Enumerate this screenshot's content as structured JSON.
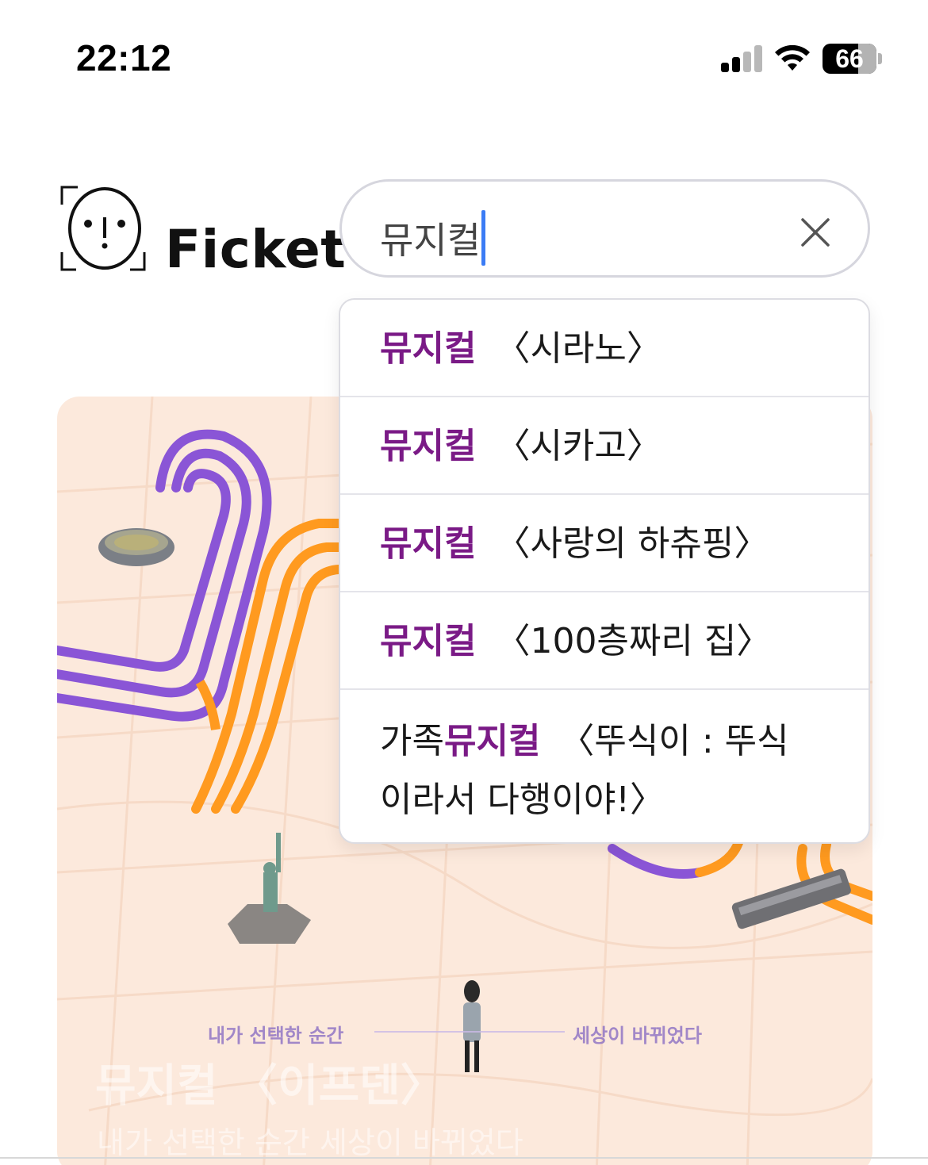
{
  "status_bar": {
    "time": "22:12",
    "battery": "66",
    "icons": [
      "signal-icon",
      "wifi-icon",
      "battery-icon"
    ]
  },
  "logo": {
    "text": "Ficket",
    "icon": "face-logo-icon"
  },
  "search": {
    "value": "뮤지컬",
    "clear_icon": "close-icon"
  },
  "suggestions": [
    {
      "prefix": "",
      "match": "뮤지컬",
      "rest": "〈시라노〉"
    },
    {
      "prefix": "",
      "match": "뮤지컬",
      "rest": "〈시카고〉"
    },
    {
      "prefix": "",
      "match": "뮤지컬",
      "rest": "〈사랑의 하츄핑〉"
    },
    {
      "prefix": "",
      "match": "뮤지컬",
      "rest": "〈100층짜리 집〉"
    },
    {
      "prefix": "가족",
      "match": "뮤지컬",
      "rest": "〈뚜식이 : 뚜식이라서 다행이야!〉"
    }
  ],
  "banner": {
    "title": "뮤지컬 〈이프덴〉",
    "subtitle": "내가 선택한 순간 세상이 바뀌었다",
    "tag_left": "내가 선택한 순간",
    "tag_right": "세상이 바뀌었다"
  },
  "colors": {
    "highlight": "#7a1a86",
    "caret": "#3b7cf5",
    "line_purple": "#8a55d6",
    "line_orange": "#ff9a1f",
    "banner_bg": "#fce9dc"
  }
}
